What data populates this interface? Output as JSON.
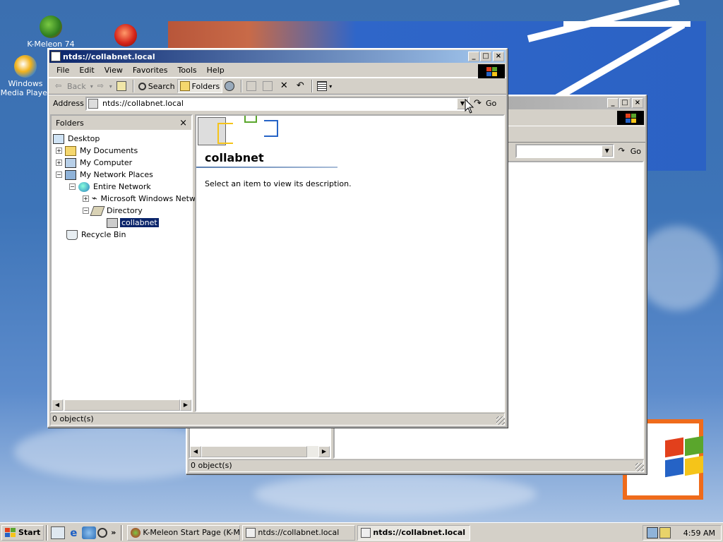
{
  "desktop": {
    "icons": [
      {
        "label": "K-Meleon 74"
      },
      {
        "label": "Windows Media Player"
      }
    ]
  },
  "front_window": {
    "title": "ntds://collabnet.local",
    "caption_buttons": [
      "_",
      "□",
      "×"
    ],
    "menu": [
      "File",
      "Edit",
      "View",
      "Favorites",
      "Tools",
      "Help"
    ],
    "toolbar": {
      "back": "Back",
      "search": "Search",
      "folders": "Folders"
    },
    "address": {
      "label": "Address",
      "value": "ntds://collabnet.local",
      "go": "Go"
    },
    "folders_pane": {
      "header": "Folders",
      "close": "×",
      "tree": [
        {
          "label": "Desktop"
        },
        {
          "label": "My Documents",
          "expander": "+"
        },
        {
          "label": "My Computer",
          "expander": "+"
        },
        {
          "label": "My Network Places",
          "expander": "−"
        },
        {
          "label": "Entire Network",
          "expander": "−"
        },
        {
          "label": "Microsoft Windows Network",
          "expander": "+"
        },
        {
          "label": "Directory",
          "expander": "−"
        },
        {
          "label": "collabnet",
          "selected": true
        },
        {
          "label": "Recycle Bin"
        }
      ]
    },
    "content": {
      "title": "collabnet",
      "description": "Select an item to view its description."
    },
    "status": "0 object(s)"
  },
  "back_window": {
    "go": "Go",
    "status": "0 object(s)"
  },
  "taskbar": {
    "start": "Start",
    "tasks": [
      {
        "label": "K-Meleon Start Page (K-M...",
        "active": false
      },
      {
        "label": "ntds://collabnet.local",
        "active": false
      },
      {
        "label": "ntds://collabnet.local",
        "active": true
      }
    ],
    "clock": "4:59 AM"
  },
  "colors": {
    "title_active": "#0a246a",
    "title_gradient_end": "#a6caf0",
    "face": "#d4d0c8",
    "desktop": "#3a6ea5",
    "selection": "#0a246a"
  }
}
